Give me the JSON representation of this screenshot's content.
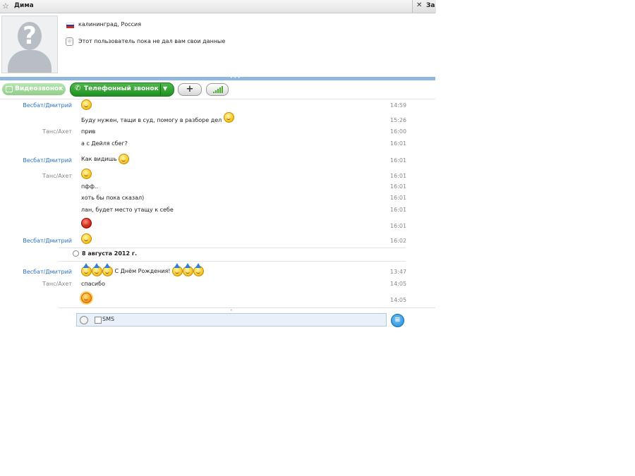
{
  "titlebar": {
    "contact_name": "Дима",
    "second_tab_label": "За"
  },
  "profile": {
    "location": "калининград, Россия",
    "info": "Этот пользователь пока не дал вам свои данные",
    "avatar_placeholder": "?",
    "flag_colors": [
      "#ffffff",
      "#1c3fb8",
      "#d52b1e"
    ]
  },
  "toolbar": {
    "video_call_label": "Видеозвонок",
    "phone_call_label": "Телефонный звонок",
    "add_label": "+"
  },
  "chat": {
    "messages": [
      {
        "sender": "Весбат/Дмитрий",
        "sender_type": "blue",
        "text": "",
        "emoticon": "smile",
        "time": "14:59"
      },
      {
        "sender": "",
        "sender_type": "blue",
        "text": "Буду нужен, тащи в суд, помогу в разборе дел",
        "emoticon": "smile",
        "time": "15:26"
      },
      {
        "sender": "Танс/Ахет",
        "sender_type": "gray",
        "text": "прив",
        "emoticon": "",
        "time": "16:00"
      },
      {
        "sender": "",
        "sender_type": "gray",
        "text": "а с Дейля сбег?",
        "emoticon": "",
        "time": "16:01"
      },
      {
        "sender": "Весбат/Дмитрий",
        "sender_type": "blue",
        "text": "Как видишь",
        "emoticon": "smile",
        "time": "16:01"
      },
      {
        "sender": "Танс/Ахет",
        "sender_type": "gray",
        "text": "",
        "emoticon": "smile",
        "time": "16:01"
      },
      {
        "sender": "",
        "sender_type": "gray",
        "text": "пфф..",
        "emoticon": "",
        "time": "16:01"
      },
      {
        "sender": "",
        "sender_type": "gray",
        "text": "хоть бы пока сказал)",
        "emoticon": "",
        "time": "16:01"
      },
      {
        "sender": "",
        "sender_type": "gray",
        "text": "лан, будет место утащу к себе",
        "emoticon": "",
        "time": "16:01"
      },
      {
        "sender": "",
        "sender_type": "gray",
        "text": "",
        "emoticon": "devil",
        "time": "16:01"
      },
      {
        "sender": "Весбат/Дмитрий",
        "sender_type": "blue",
        "text": "",
        "emoticon": "smile",
        "time": "16:02"
      }
    ],
    "date_separator": "8 августа 2012 г.",
    "messages2": [
      {
        "sender": "Весбат/Дмитрий",
        "sender_type": "blue",
        "text": "С Днём Рождения!",
        "emoticon": "party",
        "time": "13:47"
      },
      {
        "sender": "Танс/Ахет",
        "sender_type": "gray",
        "text": "спасибо",
        "emoticon": "",
        "time": "14:05"
      },
      {
        "sender": "",
        "sender_type": "gray",
        "text": "",
        "emoticon": "sun",
        "time": "14:05"
      }
    ]
  },
  "input": {
    "sms_label": "SMS"
  }
}
